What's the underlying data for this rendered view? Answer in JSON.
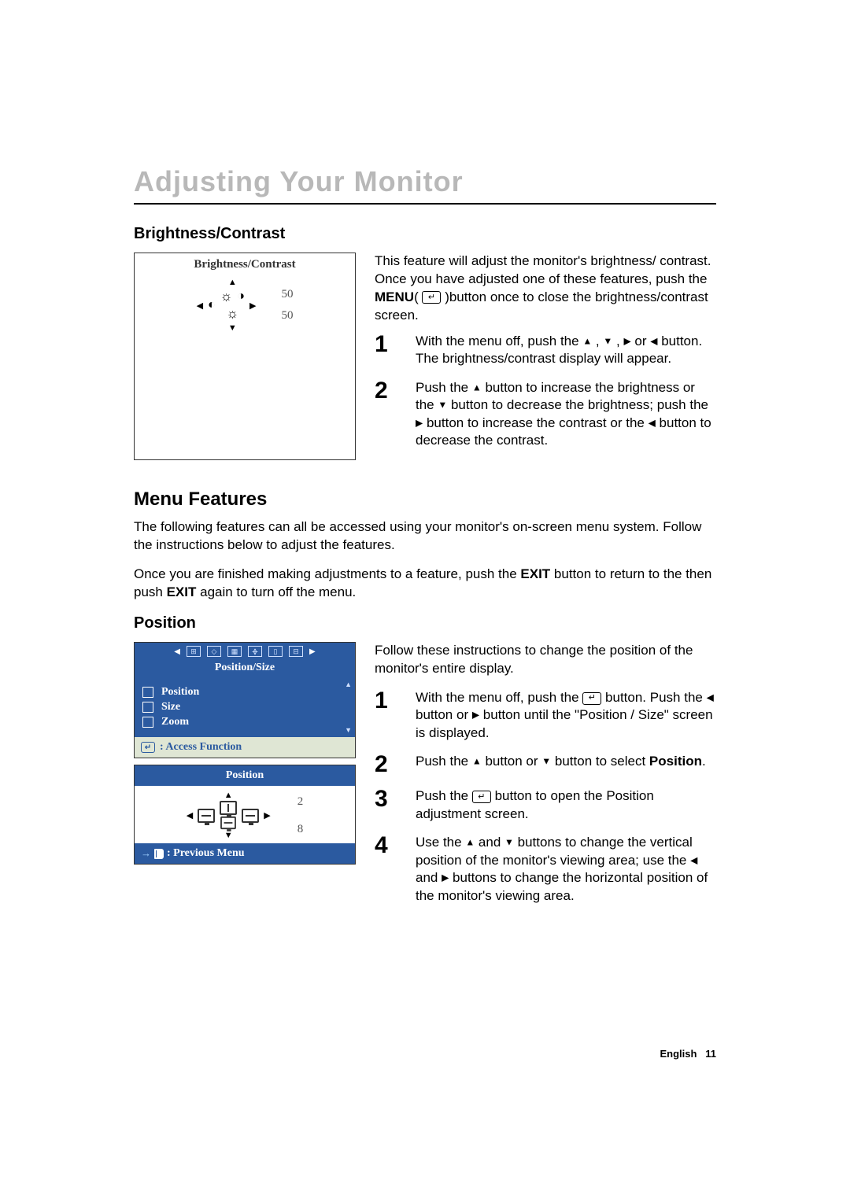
{
  "title": "Adjusting Your Monitor",
  "bc": {
    "heading": "Brightness/Contrast",
    "osd_title": "Brightness/Contrast",
    "val1": "50",
    "val2": "50",
    "intro": "This feature will adjust the monitor's brightness/ contrast. Once you have adjusted one of these features, push the ",
    "intro_menu": "MENU",
    "intro2": "(",
    "intro3": " )button once to close the brightness/contrast screen.",
    "step1a": "With the menu off, push the ",
    "step1b": " , ",
    "step1c": " , ",
    "step1d": " or ",
    "step1e": " button. The brightness/contrast display will appear.",
    "step2a": "Push the ",
    "step2b": " button to increase the brightness or the ",
    "step2c": " button to decrease the brightness; push the ",
    "step2d": " button to increase the contrast or the ",
    "step2e": " button to decrease the contrast."
  },
  "mf": {
    "heading": "Menu Features",
    "p1": "The following features can all be accessed using your monitor's on-screen menu system. Follow the instructions below to adjust the features.",
    "p2a": "Once you are finished making adjustments to a feature, push the ",
    "p2exit": "EXIT",
    "p2b": " button to return to the then push ",
    "p2exit2": "EXIT",
    "p2c": " again to turn off the menu."
  },
  "pos": {
    "heading": "Position",
    "osd_tab_title": "Position/Size",
    "menu_item1": "Position",
    "menu_item2": "Size",
    "menu_item3": "Zoom",
    "access": ": Access Function",
    "osd2_title": "Position",
    "val1": "2",
    "val2": "8",
    "prev": ": Previous Menu",
    "intro": "Follow these instructions to change the position of the monitor's entire display.",
    "step1a": "With the menu off, push the ",
    "step1b": " button. Push the ",
    "step1c": " button or ",
    "step1d": " button until the \"Position / Size\" screen is displayed.",
    "step2a": "Push the ",
    "step2b": " button or ",
    "step2c": " button to select ",
    "step2pos": "Position",
    "step2d": ".",
    "step3a": "Push the ",
    "step3b": " button to open the Position adjustment screen.",
    "step4a": "Use the ",
    "step4b": " and ",
    "step4c": " buttons to change the vertical position of the monitor's viewing area; use the ",
    "step4d": " and ",
    "step4e": " buttons to change the horizontal position of the monitor's viewing area."
  },
  "footer": {
    "lang": "English",
    "page": "11"
  }
}
